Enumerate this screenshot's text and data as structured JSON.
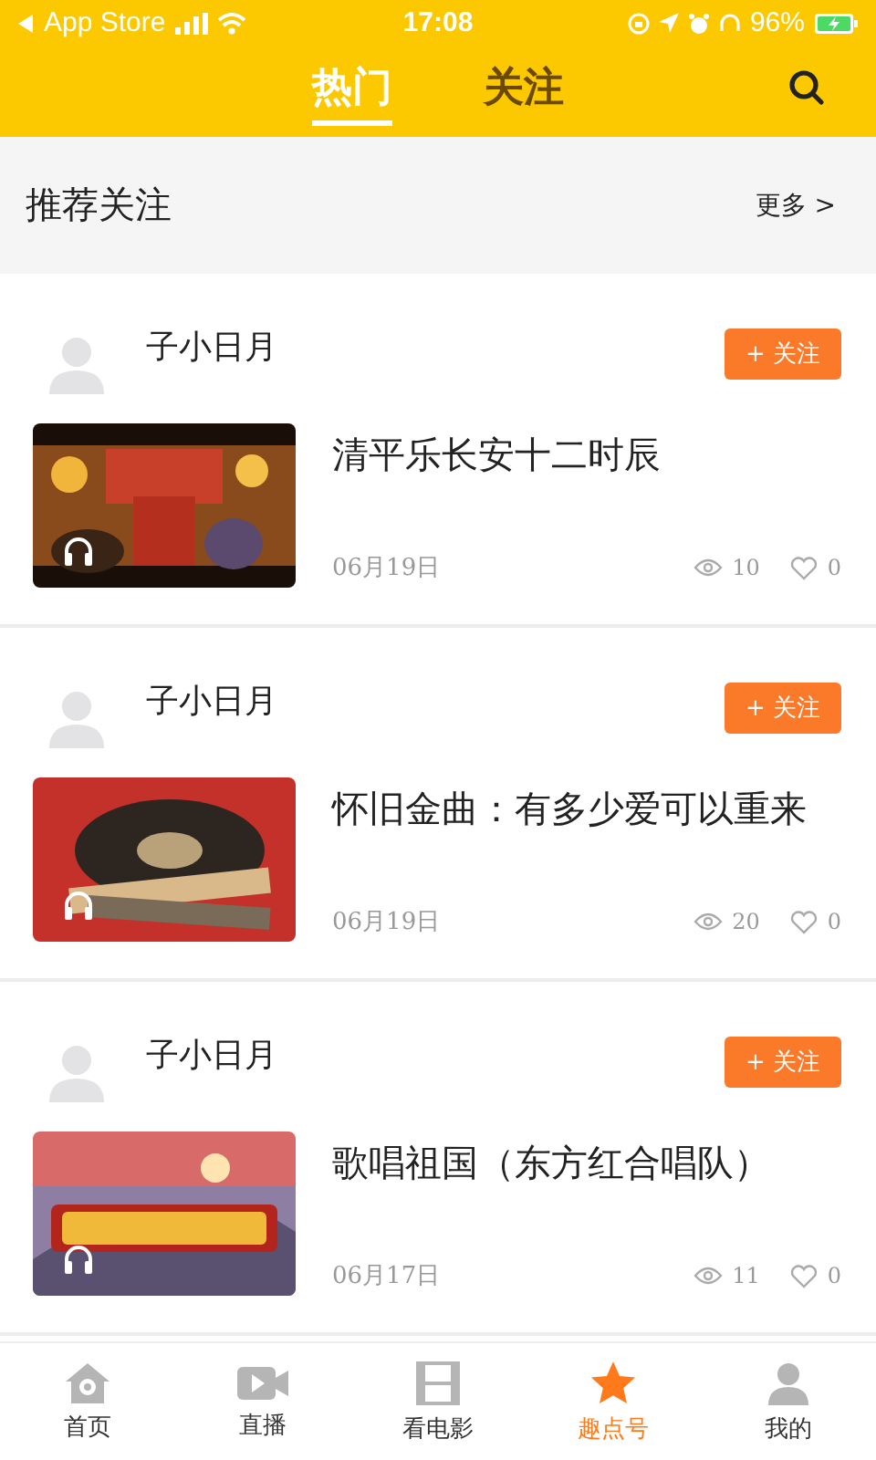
{
  "status_bar": {
    "carrier": "App Store",
    "time": "17:08",
    "battery": "96%"
  },
  "tabs": [
    {
      "label": "热门",
      "selected": true
    },
    {
      "label": "关注",
      "selected": false
    }
  ],
  "section": {
    "title": "推荐关注",
    "more": "更多 >"
  },
  "posts": [
    {
      "author": "子小日月",
      "follow": "+ 关注",
      "title": "清平乐长安十二时辰",
      "date": "06月19日",
      "views": "10",
      "likes": "0"
    },
    {
      "author": "子小日月",
      "follow": "+ 关注",
      "title": "怀旧金曲：有多少爱可以重来",
      "date": "06月19日",
      "views": "20",
      "likes": "0"
    },
    {
      "author": "子小日月",
      "follow": "+ 关注",
      "title": "歌唱祖国（东方红合唱队）",
      "date": "06月17日",
      "views": "11",
      "likes": "0"
    }
  ],
  "nav": [
    {
      "label": "首页",
      "kind": "home",
      "selected": false
    },
    {
      "label": "直播",
      "kind": "live",
      "selected": false
    },
    {
      "label": "看电影",
      "kind": "movies",
      "selected": false
    },
    {
      "label": "趣点号",
      "kind": "channel",
      "selected": true
    },
    {
      "label": "我的",
      "kind": "profile",
      "selected": false
    }
  ]
}
